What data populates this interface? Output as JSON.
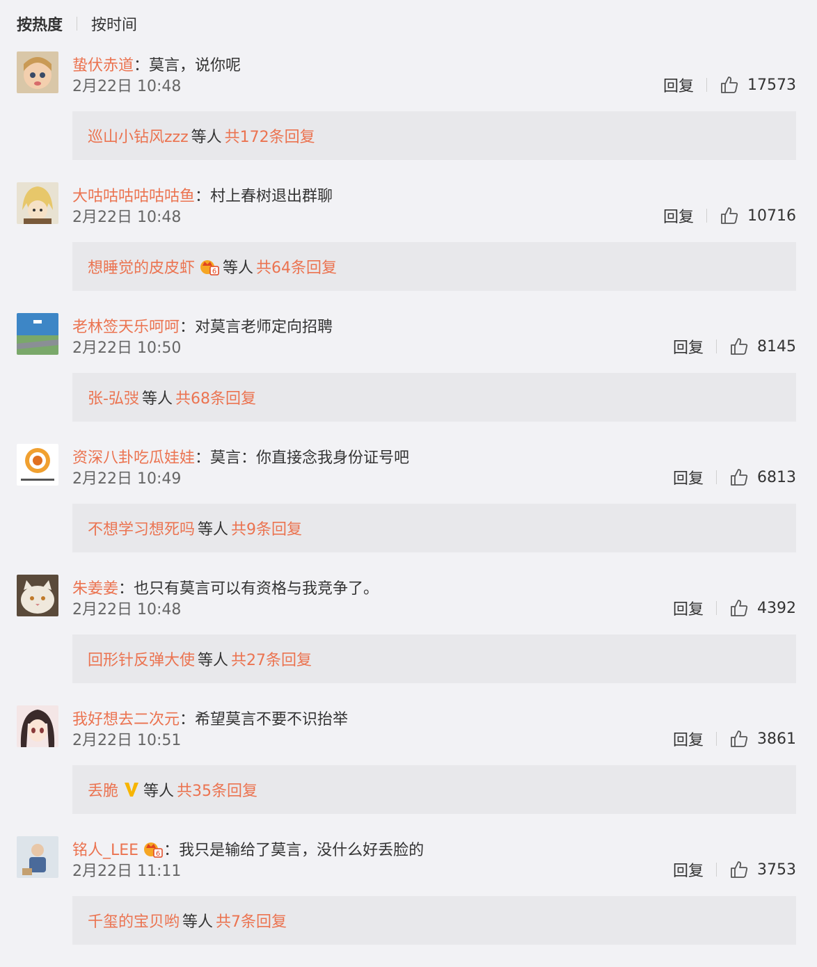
{
  "sort": {
    "hot": "按热度",
    "time": "按时间"
  },
  "labels": {
    "reply": "回复",
    "colon": "：",
    "replies_mid": "等人"
  },
  "colors": {
    "accent": "#eb7350",
    "text": "#333333",
    "muted": "#666666",
    "bg": "#f2f2f5",
    "reply_bg": "#e8e8eb"
  },
  "comments": [
    {
      "user": "蛰伏赤道",
      "content": "莫言，说你呢",
      "time": "2月22日 10:48",
      "likes": "17573",
      "reply_user": "巡山小钻风zzz",
      "reply_total": "共172条回复",
      "avatar_icon": "child-face-avatar"
    },
    {
      "user": "大咕咕咕咕咕咕鱼",
      "content": "村上春树退出群聊",
      "time": "2月22日 10:48",
      "likes": "10716",
      "reply_user": "想睡觉的皮皮虾",
      "reply_total": "共64条回复",
      "avatar_icon": "anime-blond-avatar",
      "reply_badge": "vip-crown-icon"
    },
    {
      "user": "老林签天乐呵呵",
      "content": "对莫言老师定向招聘",
      "time": "2月22日 10:50",
      "likes": "8145",
      "reply_user": "张-弘弢",
      "reply_total": "共68条回复",
      "avatar_icon": "landscape-avatar"
    },
    {
      "user": "资深八卦吃瓜娃娃",
      "content": "莫言：你直接念我身份证号吧",
      "time": "2月22日 10:49",
      "likes": "6813",
      "reply_user": "不想学习想死吗",
      "reply_total": "共9条回复",
      "avatar_icon": "orange-logo-avatar"
    },
    {
      "user": "朱姜姜",
      "content": "也只有莫言可以有资格与我竞争了。",
      "time": "2月22日 10:48",
      "likes": "4392",
      "reply_user": "回形针反弹大使",
      "reply_total": "共27条回复",
      "avatar_icon": "cat-avatar"
    },
    {
      "user": "我好想去二次元",
      "content": "希望莫言不要不识抬举",
      "time": "2月22日 10:51",
      "likes": "3861",
      "reply_user": "丢脆",
      "reply_total": "共35条回复",
      "avatar_icon": "anime-girl-avatar",
      "reply_badge": "verified-v-icon"
    },
    {
      "user": "铭人_LEE",
      "content": "我只是输给了莫言，没什么好丢脸的",
      "time": "2月22日 11:11",
      "likes": "3753",
      "reply_user": "千玺的宝贝哟",
      "reply_total": "共7条回复",
      "avatar_icon": "photo-avatar",
      "user_badge": "vip-crown-icon"
    }
  ]
}
